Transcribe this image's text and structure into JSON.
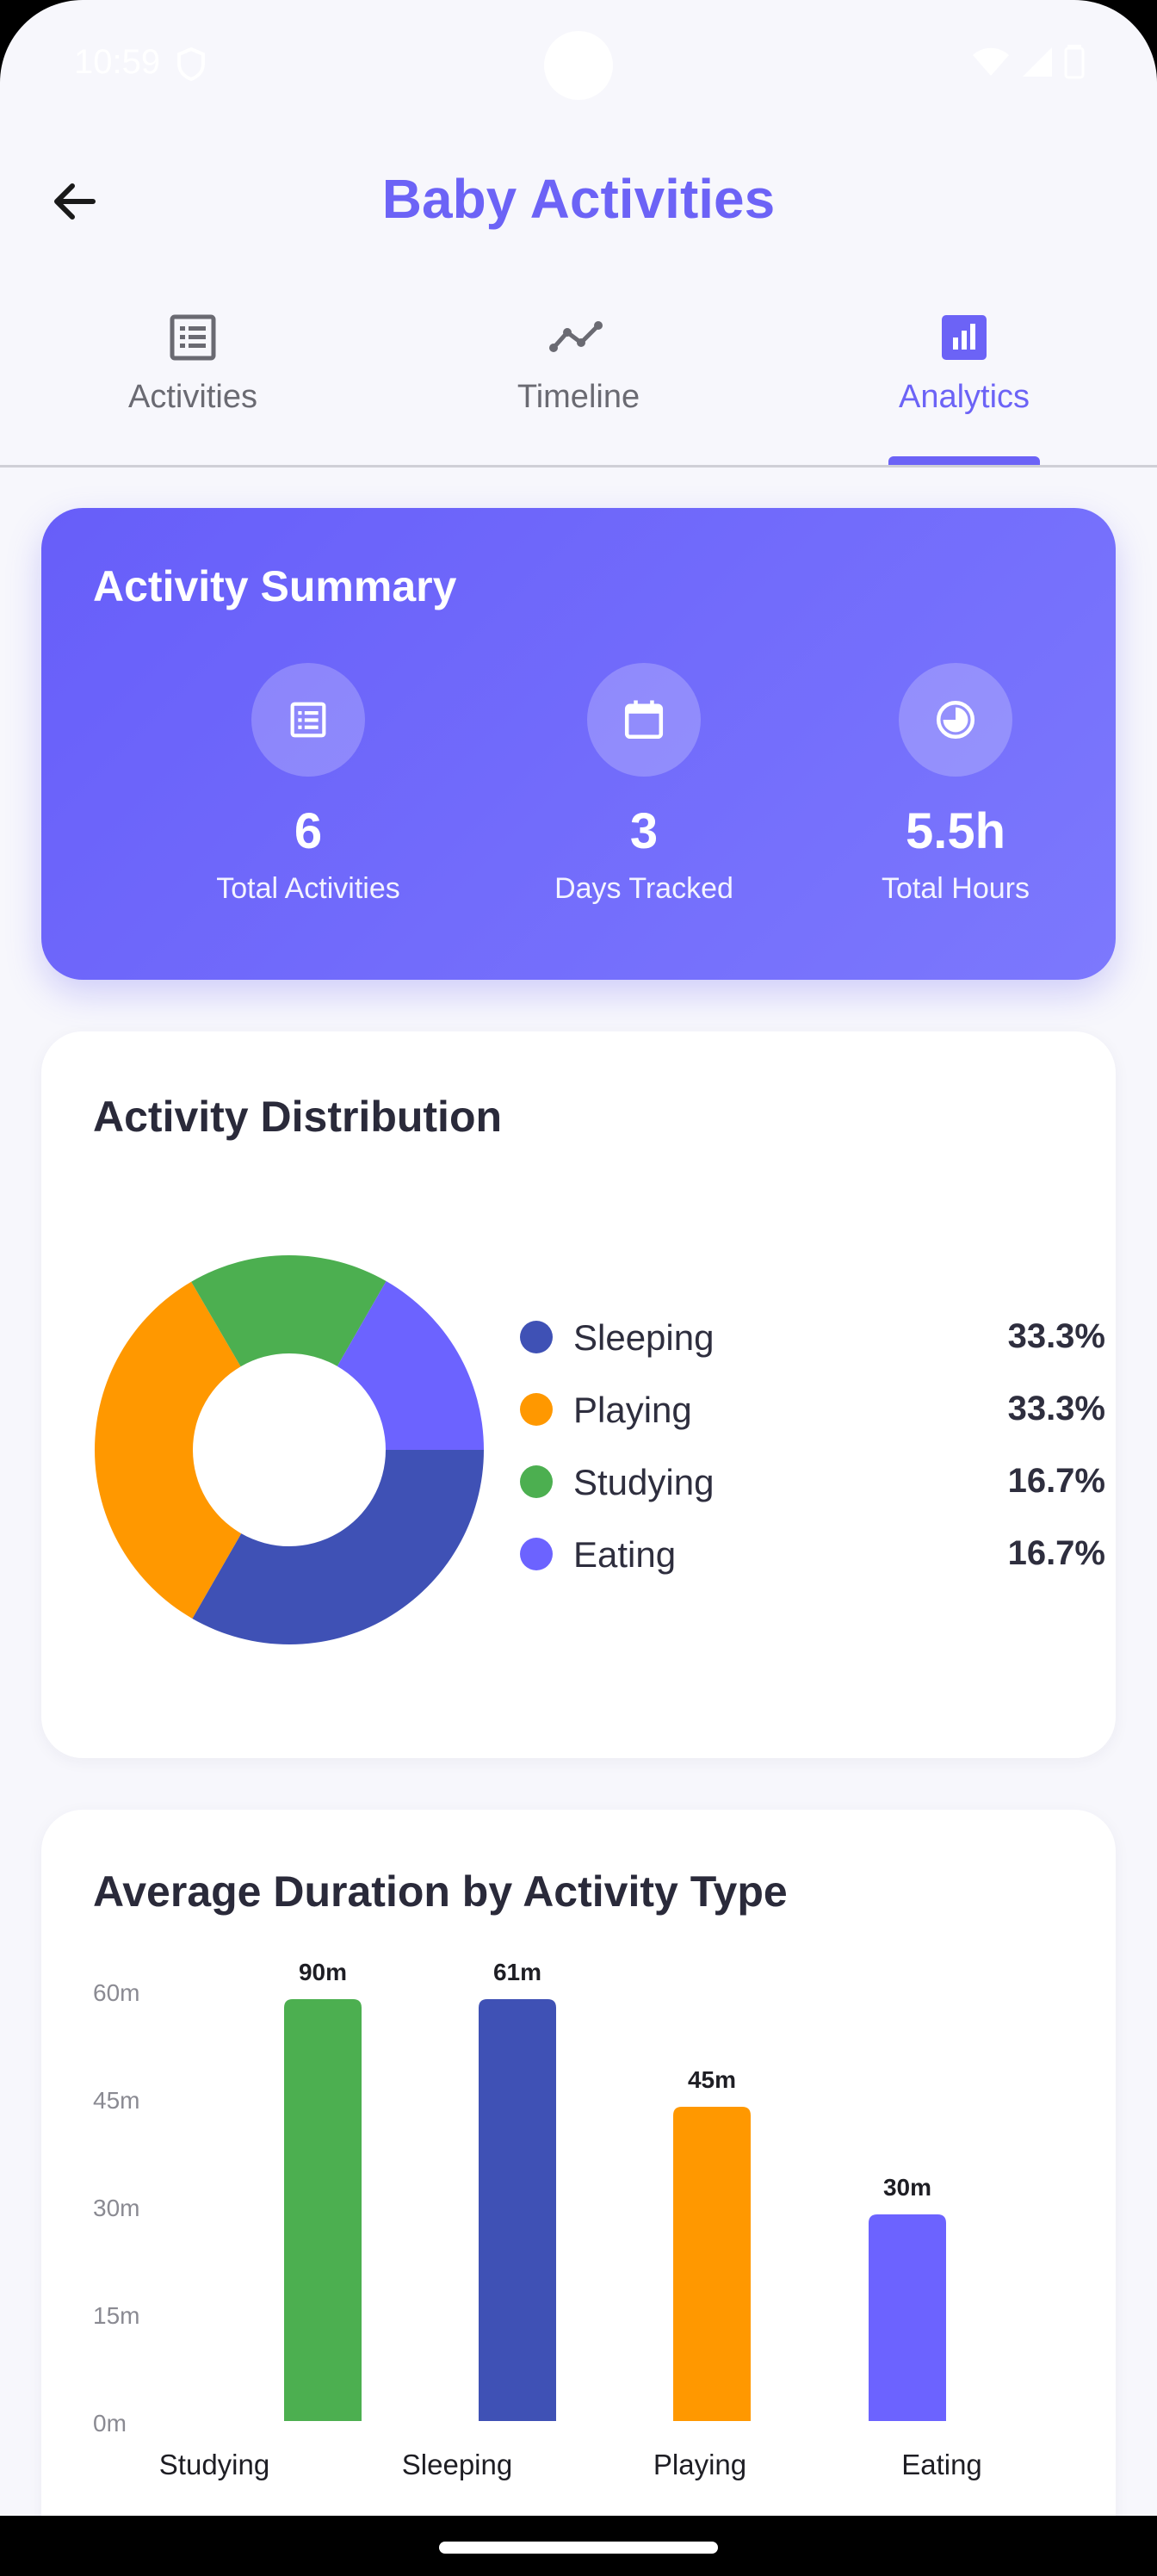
{
  "status_bar": {
    "time": "10:59"
  },
  "app_bar": {
    "title": "Baby Activities"
  },
  "tabs": [
    {
      "label": "Activities",
      "icon": "list-icon",
      "active": false
    },
    {
      "label": "Timeline",
      "icon": "timeline-icon",
      "active": false
    },
    {
      "label": "Analytics",
      "icon": "analytics-icon",
      "active": true
    }
  ],
  "summary": {
    "title": "Activity Summary",
    "stats": [
      {
        "value": "6",
        "label": "Total Activities",
        "icon": "list-icon"
      },
      {
        "value": "3",
        "label": "Days Tracked",
        "icon": "calendar-icon"
      },
      {
        "value": "5.5h",
        "label": "Total Hours",
        "icon": "clock-icon"
      }
    ]
  },
  "distribution": {
    "title": "Activity Distribution",
    "items": [
      {
        "name": "Sleeping",
        "percent": "33.3%"
      },
      {
        "name": "Playing",
        "percent": "33.3%"
      },
      {
        "name": "Studying",
        "percent": "16.7%"
      },
      {
        "name": "Eating",
        "percent": "16.7%"
      }
    ]
  },
  "duration": {
    "title": "Average Duration by Activity Type"
  },
  "colors": {
    "accent": "#6c63f6",
    "sleeping": "#3f51b5",
    "playing": "#ff9800",
    "studying": "#4caf50",
    "eating": "#6c63ff"
  },
  "chart_data": [
    {
      "type": "pie",
      "title": "Activity Distribution",
      "categories": [
        "Sleeping",
        "Playing",
        "Studying",
        "Eating"
      ],
      "values": [
        33.3,
        33.3,
        16.7,
        16.7
      ],
      "colors": [
        "#3f51b5",
        "#ff9800",
        "#4caf50",
        "#6c63ff"
      ],
      "legend": "right"
    },
    {
      "type": "bar",
      "title": "Average Duration by Activity Type",
      "categories": [
        "Studying",
        "Sleeping",
        "Playing",
        "Eating"
      ],
      "values": [
        90,
        61,
        45,
        30
      ],
      "value_labels": [
        "90m",
        "61m",
        "45m",
        "30m"
      ],
      "colors": [
        "#4caf50",
        "#3f51b5",
        "#ff9800",
        "#6c63ff"
      ],
      "ylim": [
        0,
        60
      ],
      "yticks": [
        "0m",
        "15m",
        "30m",
        "45m",
        "60m"
      ],
      "xlabel": "",
      "ylabel": ""
    }
  ]
}
